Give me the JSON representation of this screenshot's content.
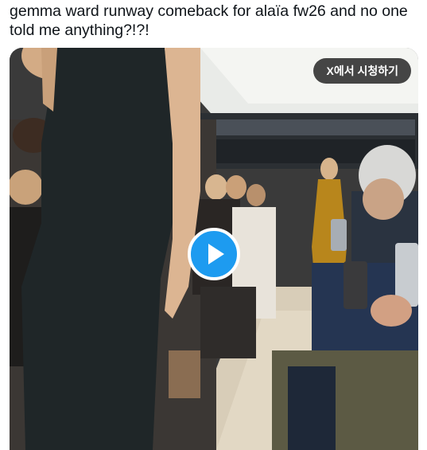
{
  "tweet": {
    "text": "gemma ward runway comeback for alaïa fw26 and no one told me anything?!?!"
  },
  "media": {
    "watch_on_x_label": "X에서 시청하기",
    "play_icon": "play-icon",
    "accent_color": "#1d9bf0"
  }
}
